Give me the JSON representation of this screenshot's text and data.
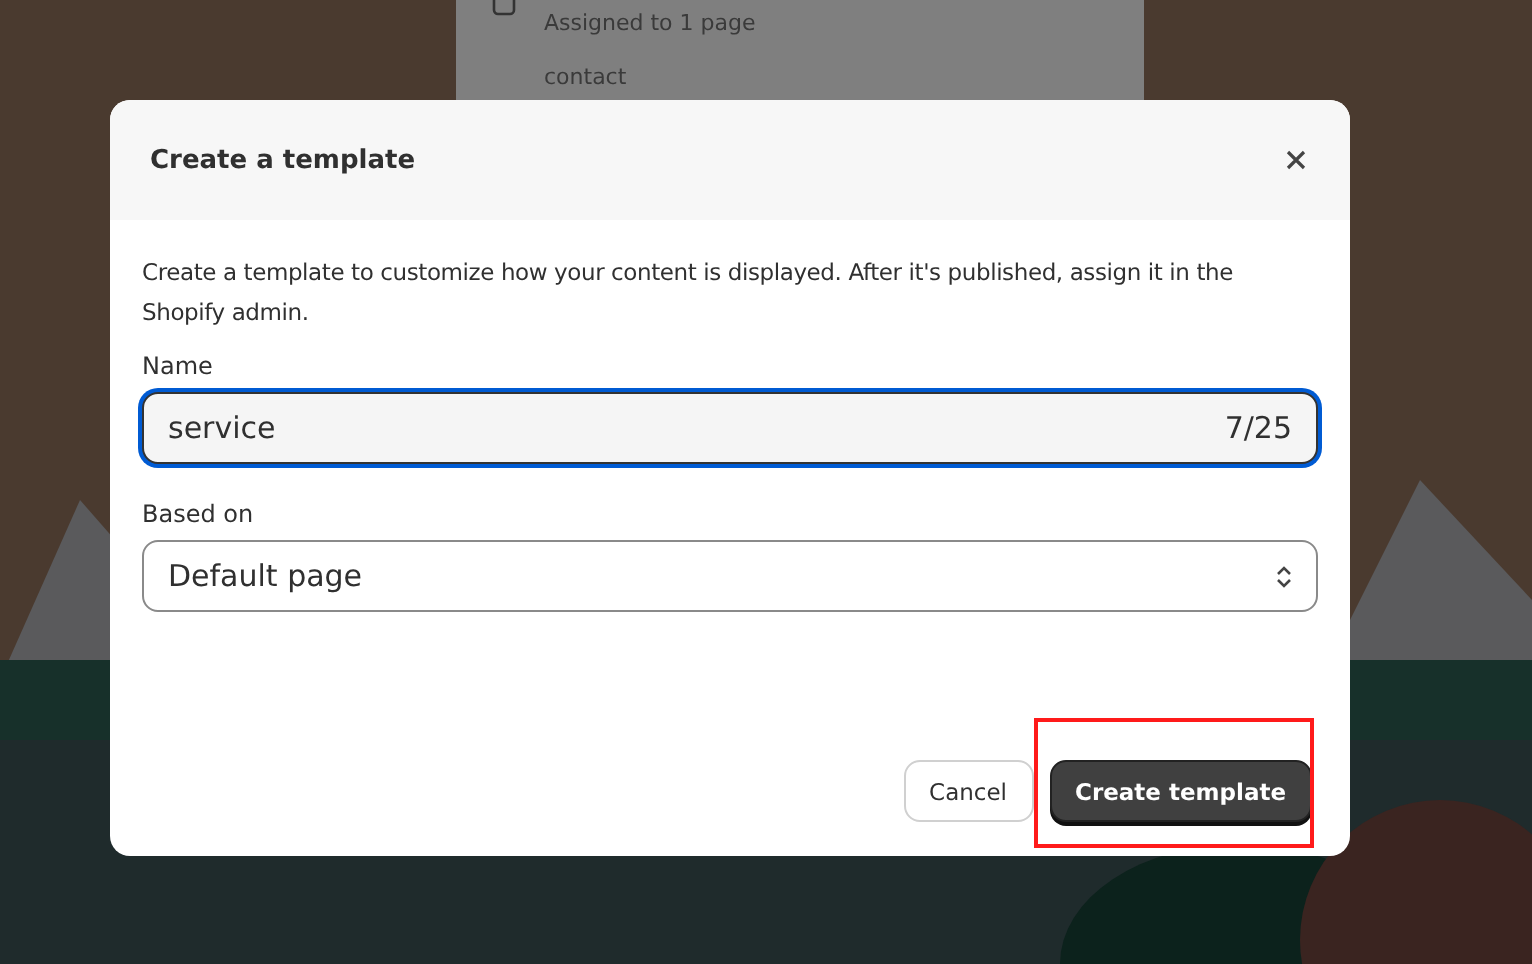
{
  "background_panel": {
    "assignment": "Assigned to 1 page",
    "item": "contact"
  },
  "dialog": {
    "title": "Create a template",
    "description": "Create a template to customize how your content is displayed. After it's published, assign it in the Shopify admin.",
    "name_field": {
      "label": "Name",
      "value": "service",
      "counter": "7/25",
      "focused": true
    },
    "based_on": {
      "label": "Based on",
      "value": "Default page"
    },
    "buttons": [
      {
        "label": "Cancel",
        "kind": "secondary",
        "highlighted": false
      },
      {
        "label": "Create template",
        "kind": "primary",
        "highlighted": true
      }
    ]
  }
}
